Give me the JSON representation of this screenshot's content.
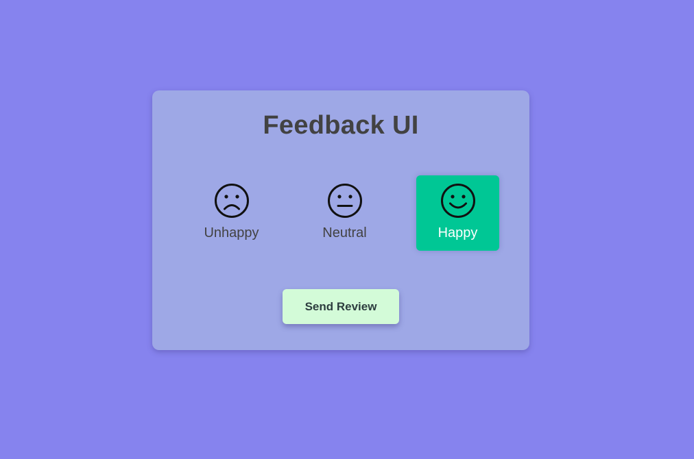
{
  "title": "Feedback UI",
  "ratings": [
    {
      "label": "Unhappy",
      "icon": "frown-face-icon",
      "selected": false
    },
    {
      "label": "Neutral",
      "icon": "neutral-face-icon",
      "selected": false
    },
    {
      "label": "Happy",
      "icon": "smile-face-icon",
      "selected": true
    }
  ],
  "send_button_label": "Send Review",
  "colors": {
    "background": "#8683ee",
    "panel": "#9ea8e6",
    "selected": "#00c795",
    "button": "#d3fbd8",
    "text": "#424242"
  }
}
